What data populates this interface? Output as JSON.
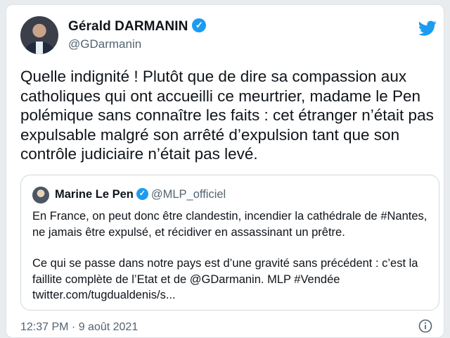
{
  "author": {
    "name": "Gérald DARMANIN",
    "handle": "@GDarmanin",
    "verified_icon": "verified-badge-icon",
    "avatar_icon": "profile-photo"
  },
  "brand": {
    "icon": "twitter-bird-icon",
    "color": "#1d9bf0"
  },
  "tweet": {
    "text": "Quelle indignité ! Plutôt que de dire sa compassion aux catholiques qui ont accueilli ce meurtrier, madame le Pen polémique sans connaître les faits : cet étranger n’était pas expulsable malgré son arrêté d’expulsion tant que son contrôle judiciaire n’était pas levé."
  },
  "quoted_tweet": {
    "name": "Marine Le Pen",
    "handle": "@MLP_officiel",
    "paragraph_1": "En France, on peut donc être clandestin, incendier la cathédrale de #Nantes, ne jamais être expulsé, et récidiver en assassinant un prêtre.",
    "paragraph_2": "Ce qui se passe dans notre pays est d’une gravité sans précédent : c’est la faillite complète de l’Etat et de @GDarmanin. MLP #Vendée twitter.com/tugdualdenis/s..."
  },
  "meta": {
    "timestamp": "12:37 PM · 9 août 2021",
    "info_icon": "info-icon"
  },
  "colors": {
    "text": "#0f1419",
    "secondary_text": "#536471",
    "border": "#cfd9de",
    "accent": "#1d9bf0"
  }
}
